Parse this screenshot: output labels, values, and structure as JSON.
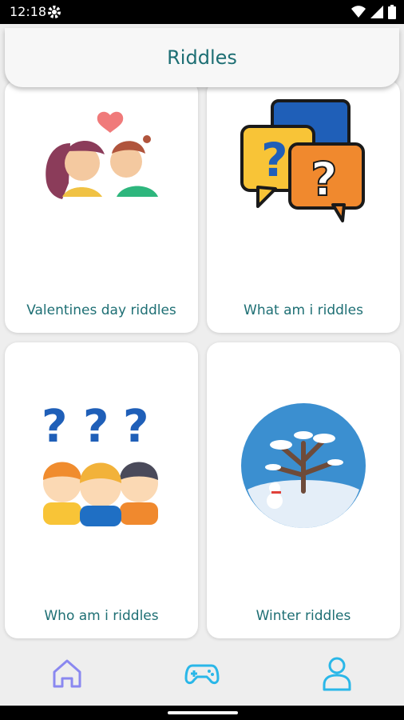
{
  "status_bar": {
    "time": "12:18"
  },
  "app_bar": {
    "title": "Riddles"
  },
  "cards": [
    {
      "label": "Valentines day riddles",
      "icon": "kissing-couple-icon"
    },
    {
      "label": "What am i riddles",
      "icon": "question-bubbles-icon"
    },
    {
      "label": "Who am i riddles",
      "icon": "people-questions-icon"
    },
    {
      "label": "Winter riddles",
      "icon": "winter-tree-icon"
    }
  ],
  "bottom_nav": {
    "items": [
      {
        "name": "home",
        "icon": "home-icon"
      },
      {
        "name": "games",
        "icon": "gamepad-icon",
        "active": true
      },
      {
        "name": "profile",
        "icon": "user-icon"
      }
    ],
    "colors": {
      "home": "#8a88f0",
      "games": "#2ab7e8",
      "profile": "#2ab7e8"
    }
  },
  "colors": {
    "accent_text": "#1e6f74",
    "background": "#eeeeee",
    "card": "#ffffff"
  }
}
